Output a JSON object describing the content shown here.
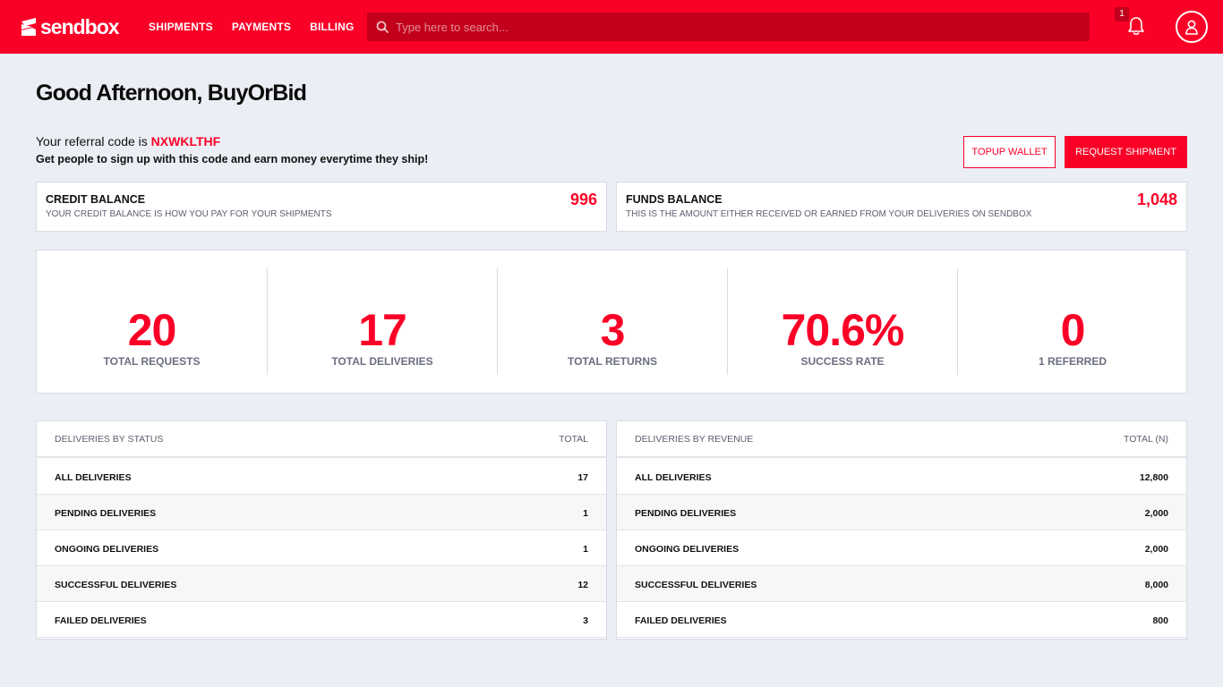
{
  "header": {
    "brand": "sendbox",
    "nav": [
      "SHIPMENTS",
      "PAYMENTS",
      "BILLING"
    ],
    "search_placeholder": "Type here to search...",
    "notification_count": "1"
  },
  "greeting": "Good Afternoon, BuyOrBid",
  "referral": {
    "prefix": "Your referral code is",
    "code": "NXWKLTHF",
    "subtext": "Get people to sign up with this code and earn money everytime they ship!"
  },
  "actions": {
    "topup_label": "TOPUP WALLET",
    "request_label": "REQUEST SHIPMENT"
  },
  "balances": {
    "credit": {
      "title": "CREDIT BALANCE",
      "subtitle": "YOUR CREDIT BALANCE IS HOW YOU PAY FOR YOUR SHIPMENTS",
      "value": "996"
    },
    "funds": {
      "title": "FUNDS BALANCE",
      "subtitle": "THIS IS THE AMOUNT EITHER RECEIVED OR EARNED FROM YOUR DELIVERIES ON SENDBOX",
      "value": "1,048"
    }
  },
  "stats": [
    {
      "value": "20",
      "label": "TOTAL REQUESTS"
    },
    {
      "value": "17",
      "label": "TOTAL DELIVERIES"
    },
    {
      "value": "3",
      "label": "TOTAL RETURNS"
    },
    {
      "value": "70.6%",
      "label": "SUCCESS RATE"
    },
    {
      "value": "0",
      "label": "1 REFERRED"
    }
  ],
  "status_table": {
    "header_left": "DELIVERIES BY STATUS",
    "header_right": "TOTAL",
    "rows": [
      {
        "label": "ALL DELIVERIES",
        "value": "17"
      },
      {
        "label": "PENDING DELIVERIES",
        "value": "1"
      },
      {
        "label": "ONGOING DELIVERIES",
        "value": "1"
      },
      {
        "label": "SUCCESSFUL DELIVERIES",
        "value": "12"
      },
      {
        "label": "FAILED DELIVERIES",
        "value": "3"
      }
    ]
  },
  "revenue_table": {
    "header_left": "DELIVERIES BY REVENUE",
    "header_right": "TOTAL (N)",
    "rows": [
      {
        "label": "ALL DELIVERIES",
        "value": "12,800"
      },
      {
        "label": "PENDING DELIVERIES",
        "value": "2,000"
      },
      {
        "label": "ONGOING DELIVERIES",
        "value": "2,000"
      },
      {
        "label": "SUCCESSFUL DELIVERIES",
        "value": "8,000"
      },
      {
        "label": "FAILED DELIVERIES",
        "value": "800"
      }
    ]
  },
  "colors": {
    "brand_red": "#fb0027",
    "search_bg": "#c3001b",
    "page_bg": "#eceef5",
    "muted_text": "#6b6f80"
  },
  "icons": [
    "sendbox-logo-icon",
    "search-icon",
    "bell-icon",
    "user-icon"
  ]
}
